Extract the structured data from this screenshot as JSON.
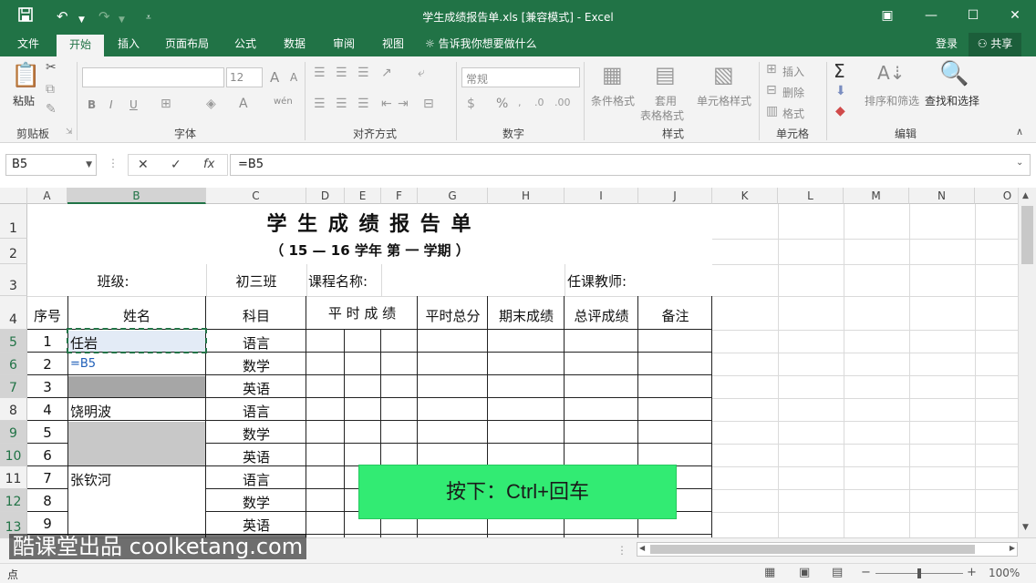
{
  "title_bar": {
    "title": "学生成绩报告单.xls  [兼容模式] - Excel",
    "save_icon": "save-icon",
    "undo_icon": "undo-icon",
    "redo_icon": "redo-icon",
    "customize_icon": "customize-qat-icon"
  },
  "window": {
    "ribbon_options": "▣",
    "minimize": "—",
    "maximize": "☐",
    "close": "✕"
  },
  "tabs": [
    "文件",
    "开始",
    "插入",
    "页面布局",
    "公式",
    "数据",
    "审阅",
    "视图"
  ],
  "tell_me": "告诉我你想要做什么",
  "sign_in": "登录",
  "share": "共享",
  "ribbon": {
    "clipboard": {
      "paste": "粘贴",
      "label": "剪贴板"
    },
    "font": {
      "size": "12",
      "bold": "B",
      "italic": "I",
      "underline": "U",
      "label": "字体"
    },
    "alignment": {
      "label": "对齐方式"
    },
    "number": {
      "format": "常规",
      "percent": "%",
      "label": "数字"
    },
    "styles": {
      "conditional": "条件格式",
      "table1": "套用",
      "table2": "表格格式",
      "cell_styles": "单元格样式",
      "label": "样式"
    },
    "cells": {
      "insert": "插入",
      "delete": "删除",
      "format": "格式",
      "label": "单元格"
    },
    "editing": {
      "sort": "排序和筛选",
      "find": "查找和选择",
      "label": "编辑"
    }
  },
  "formula_bar": {
    "name_box": "B5",
    "cancel": "✕",
    "enter": "✓",
    "fx": "fx",
    "formula": "=B5"
  },
  "columns": [
    "A",
    "B",
    "C",
    "D",
    "E",
    "F",
    "G",
    "H",
    "I",
    "J",
    "K",
    "L",
    "M",
    "N",
    "O"
  ],
  "rows": [
    "1",
    "2",
    "3",
    "4",
    "5",
    "6",
    "7",
    "8",
    "9",
    "10",
    "11",
    "12",
    "13"
  ],
  "sheet": {
    "title": "学 生 成 绩 报 告 单",
    "subtitle": "（ 15 — 16    学年 第 一 学期 ）",
    "class_label": "班级:",
    "class_value": "初三班",
    "course_label": "课程名称:",
    "teacher_label": "任课教师:",
    "headers": {
      "seq": "序号",
      "name": "姓名",
      "subject": "科目",
      "usual": "平 时 成 绩",
      "usual_total": "平时总分",
      "final": "期末成绩",
      "overall": "总评成绩",
      "note": "备注"
    },
    "records": [
      {
        "seq": "1",
        "name": "任岩",
        "subject": "语言"
      },
      {
        "seq": "2",
        "name": "=B5",
        "subject": "数学"
      },
      {
        "seq": "3",
        "name": "",
        "subject": "英语"
      },
      {
        "seq": "4",
        "name": "饶明波",
        "subject": "语言"
      },
      {
        "seq": "5",
        "name": "",
        "subject": "数学"
      },
      {
        "seq": "6",
        "name": "",
        "subject": "英语"
      },
      {
        "seq": "7",
        "name": "张钦河",
        "subject": "语言"
      },
      {
        "seq": "8",
        "name": "",
        "subject": "数学"
      },
      {
        "seq": "9",
        "name": "",
        "subject": "英语"
      }
    ]
  },
  "tip": "按下：Ctrl+回车",
  "watermark": "酷课堂出品 coolketang.com",
  "status": {
    "mode": "点",
    "zoom": "100%"
  }
}
